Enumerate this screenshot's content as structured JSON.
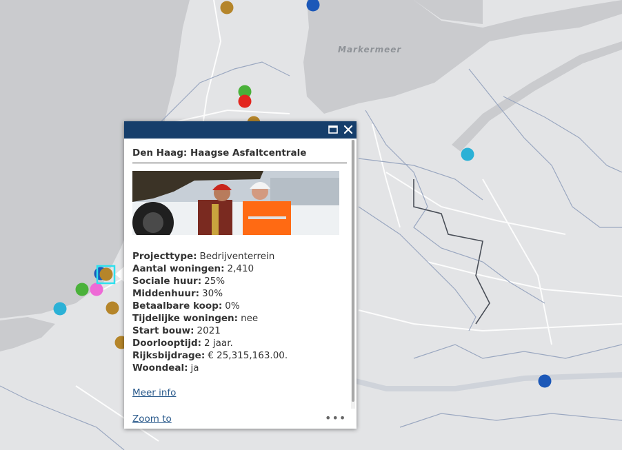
{
  "map": {
    "labels": {
      "lake": "Markermeer"
    },
    "colors": {
      "water": "#cacbce",
      "land": "#e3e4e6",
      "roads": "#ffffff",
      "borders": "#9aa7c0"
    },
    "markers": [
      {
        "color": "#b5852a"
      },
      {
        "color": "#1c58b8"
      },
      {
        "color": "#4ab13a"
      },
      {
        "color": "#e3261f"
      },
      {
        "color": "#b5852a"
      },
      {
        "color": "#2bb1d6"
      },
      {
        "color": "#1c58b8"
      },
      {
        "color": "#b5852a"
      },
      {
        "color": "#4ab13a"
      },
      {
        "color": "#ee6ad6"
      },
      {
        "color": "#2bb1d6"
      },
      {
        "color": "#b5852a"
      },
      {
        "color": "#b5852a"
      },
      {
        "color": "#1c58b8"
      }
    ],
    "selection_color": "#2fe0ee"
  },
  "popup": {
    "title": "Den Haag: Haagse Asfaltcentrale",
    "header_color": "#163e6b",
    "maximize_icon": "maximize-icon",
    "close_icon": "close-icon",
    "attributes": [
      {
        "key": "Projecttype:",
        "value": "Bedrijventerrein"
      },
      {
        "key": "Aantal woningen:",
        "value": "2,410"
      },
      {
        "key": "Sociale huur:",
        "value": "25%"
      },
      {
        "key": "Middenhuur:",
        "value": "30%"
      },
      {
        "key": "Betaalbare koop:",
        "value": "0%"
      },
      {
        "key": "Tijdelijke woningen:",
        "value": "nee"
      },
      {
        "key": "Start bouw:",
        "value": "2021"
      },
      {
        "key": "Doorlooptijd:",
        "value": "2 jaar."
      },
      {
        "key": "Rijksbijdrage:",
        "value": "€ 25,315,163.00."
      },
      {
        "key": "Woondeal:",
        "value": "ja"
      }
    ],
    "more_info": "Meer info",
    "zoom_to": "Zoom to",
    "more_actions": "•••"
  }
}
